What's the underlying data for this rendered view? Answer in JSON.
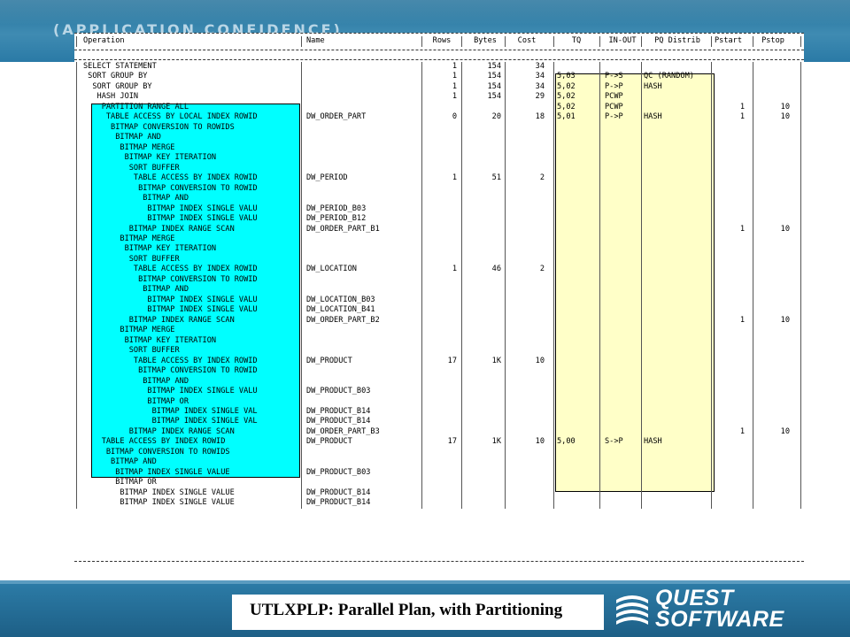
{
  "brand": "(APPLICATION CONFIDENCE)",
  "caption": "UTLXPLP: Parallel Plan, with Partitioning",
  "logo": {
    "line1": "QUEST",
    "line2": "SOFTWARE"
  },
  "plan": {
    "headers": [
      "Operation",
      "Name",
      "Rows",
      "Bytes",
      "Cost",
      "TQ",
      "IN-OUT",
      "PQ Distrib",
      "Pstart",
      "Pstop"
    ],
    "rows": [
      [
        "SELECT STATEMENT",
        "",
        "1",
        "154",
        "34",
        "",
        "",
        "",
        "",
        ""
      ],
      [
        " SORT GROUP BY",
        "",
        "1",
        "154",
        "34",
        "5,03",
        "P->S",
        "QC (RANDOM)",
        "",
        ""
      ],
      [
        "  SORT GROUP BY",
        "",
        "1",
        "154",
        "34",
        "5,02",
        "P->P",
        "HASH",
        "",
        ""
      ],
      [
        "   HASH JOIN",
        "",
        "1",
        "154",
        "29",
        "5,02",
        "PCWP",
        "",
        "",
        ""
      ],
      [
        "    PARTITION RANGE ALL",
        "",
        "",
        "",
        "",
        "5,02",
        "PCWP",
        "",
        "1",
        "10"
      ],
      [
        "     TABLE ACCESS BY LOCAL INDEX ROWID",
        "DW_ORDER_PART",
        "0",
        "20",
        "18",
        "5,01",
        "P->P",
        "HASH",
        "1",
        "10"
      ],
      [
        "      BITMAP CONVERSION TO ROWIDS",
        "",
        "",
        "",
        "",
        "",
        "",
        "",
        "",
        ""
      ],
      [
        "       BITMAP AND",
        "",
        "",
        "",
        "",
        "",
        "",
        "",
        "",
        ""
      ],
      [
        "        BITMAP MERGE",
        "",
        "",
        "",
        "",
        "",
        "",
        "",
        "",
        ""
      ],
      [
        "         BITMAP KEY ITERATION",
        "",
        "",
        "",
        "",
        "",
        "",
        "",
        "",
        ""
      ],
      [
        "          SORT BUFFER",
        "",
        "",
        "",
        "",
        "",
        "",
        "",
        "",
        ""
      ],
      [
        "           TABLE ACCESS BY INDEX ROWID",
        "DW_PERIOD",
        "1",
        "51",
        "2",
        "",
        "",
        "",
        "",
        ""
      ],
      [
        "            BITMAP CONVERSION TO ROWID",
        "",
        "",
        "",
        "",
        "",
        "",
        "",
        "",
        ""
      ],
      [
        "             BITMAP AND",
        "",
        "",
        "",
        "",
        "",
        "",
        "",
        "",
        ""
      ],
      [
        "              BITMAP INDEX SINGLE VALU",
        "DW_PERIOD_B03",
        "",
        "",
        "",
        "",
        "",
        "",
        "",
        ""
      ],
      [
        "              BITMAP INDEX SINGLE VALU",
        "DW_PERIOD_B12",
        "",
        "",
        "",
        "",
        "",
        "",
        "",
        ""
      ],
      [
        "          BITMAP INDEX RANGE SCAN",
        "DW_ORDER_PART_B1",
        "",
        "",
        "",
        "",
        "",
        "",
        "1",
        "10"
      ],
      [
        "        BITMAP MERGE",
        "",
        "",
        "",
        "",
        "",
        "",
        "",
        "",
        ""
      ],
      [
        "         BITMAP KEY ITERATION",
        "",
        "",
        "",
        "",
        "",
        "",
        "",
        "",
        ""
      ],
      [
        "          SORT BUFFER",
        "",
        "",
        "",
        "",
        "",
        "",
        "",
        "",
        ""
      ],
      [
        "           TABLE ACCESS BY INDEX ROWID",
        "DW_LOCATION",
        "1",
        "46",
        "2",
        "",
        "",
        "",
        "",
        ""
      ],
      [
        "            BITMAP CONVERSION TO ROWID",
        "",
        "",
        "",
        "",
        "",
        "",
        "",
        "",
        ""
      ],
      [
        "             BITMAP AND",
        "",
        "",
        "",
        "",
        "",
        "",
        "",
        "",
        ""
      ],
      [
        "              BITMAP INDEX SINGLE VALU",
        "DW_LOCATION_B03",
        "",
        "",
        "",
        "",
        "",
        "",
        "",
        ""
      ],
      [
        "              BITMAP INDEX SINGLE VALU",
        "DW_LOCATION_B41",
        "",
        "",
        "",
        "",
        "",
        "",
        "",
        ""
      ],
      [
        "          BITMAP INDEX RANGE SCAN",
        "DW_ORDER_PART_B2",
        "",
        "",
        "",
        "",
        "",
        "",
        "1",
        "10"
      ],
      [
        "        BITMAP MERGE",
        "",
        "",
        "",
        "",
        "",
        "",
        "",
        "",
        ""
      ],
      [
        "         BITMAP KEY ITERATION",
        "",
        "",
        "",
        "",
        "",
        "",
        "",
        "",
        ""
      ],
      [
        "          SORT BUFFER",
        "",
        "",
        "",
        "",
        "",
        "",
        "",
        "",
        ""
      ],
      [
        "           TABLE ACCESS BY INDEX ROWID",
        "DW_PRODUCT",
        "17",
        "1K",
        "10",
        "",
        "",
        "",
        "",
        ""
      ],
      [
        "            BITMAP CONVERSION TO ROWID",
        "",
        "",
        "",
        "",
        "",
        "",
        "",
        "",
        ""
      ],
      [
        "             BITMAP AND",
        "",
        "",
        "",
        "",
        "",
        "",
        "",
        "",
        ""
      ],
      [
        "              BITMAP INDEX SINGLE VALU",
        "DW_PRODUCT_B03",
        "",
        "",
        "",
        "",
        "",
        "",
        "",
        ""
      ],
      [
        "              BITMAP OR",
        "",
        "",
        "",
        "",
        "",
        "",
        "",
        "",
        ""
      ],
      [
        "               BITMAP INDEX SINGLE VAL",
        "DW_PRODUCT_B14",
        "",
        "",
        "",
        "",
        "",
        "",
        "",
        ""
      ],
      [
        "               BITMAP INDEX SINGLE VAL",
        "DW_PRODUCT_B14",
        "",
        "",
        "",
        "",
        "",
        "",
        "",
        ""
      ],
      [
        "          BITMAP INDEX RANGE SCAN",
        "DW_ORDER_PART_B3",
        "",
        "",
        "",
        "",
        "",
        "",
        "1",
        "10"
      ],
      [
        "    TABLE ACCESS BY INDEX ROWID",
        "DW_PRODUCT",
        "17",
        "1K",
        "10",
        "5,00",
        "S->P",
        "HASH",
        "",
        ""
      ],
      [
        "     BITMAP CONVERSION TO ROWIDS",
        "",
        "",
        "",
        "",
        "",
        "",
        "",
        "",
        ""
      ],
      [
        "      BITMAP AND",
        "",
        "",
        "",
        "",
        "",
        "",
        "",
        "",
        ""
      ],
      [
        "       BITMAP INDEX SINGLE VALUE",
        "DW_PRODUCT_B03",
        "",
        "",
        "",
        "",
        "",
        "",
        "",
        ""
      ],
      [
        "       BITMAP OR",
        "",
        "",
        "",
        "",
        "",
        "",
        "",
        "",
        ""
      ],
      [
        "        BITMAP INDEX SINGLE VALUE",
        "DW_PRODUCT_B14",
        "",
        "",
        "",
        "",
        "",
        "",
        "",
        ""
      ],
      [
        "        BITMAP INDEX SINGLE VALUE",
        "DW_PRODUCT_B14",
        "",
        "",
        "",
        "",
        "",
        "",
        "",
        ""
      ]
    ]
  }
}
